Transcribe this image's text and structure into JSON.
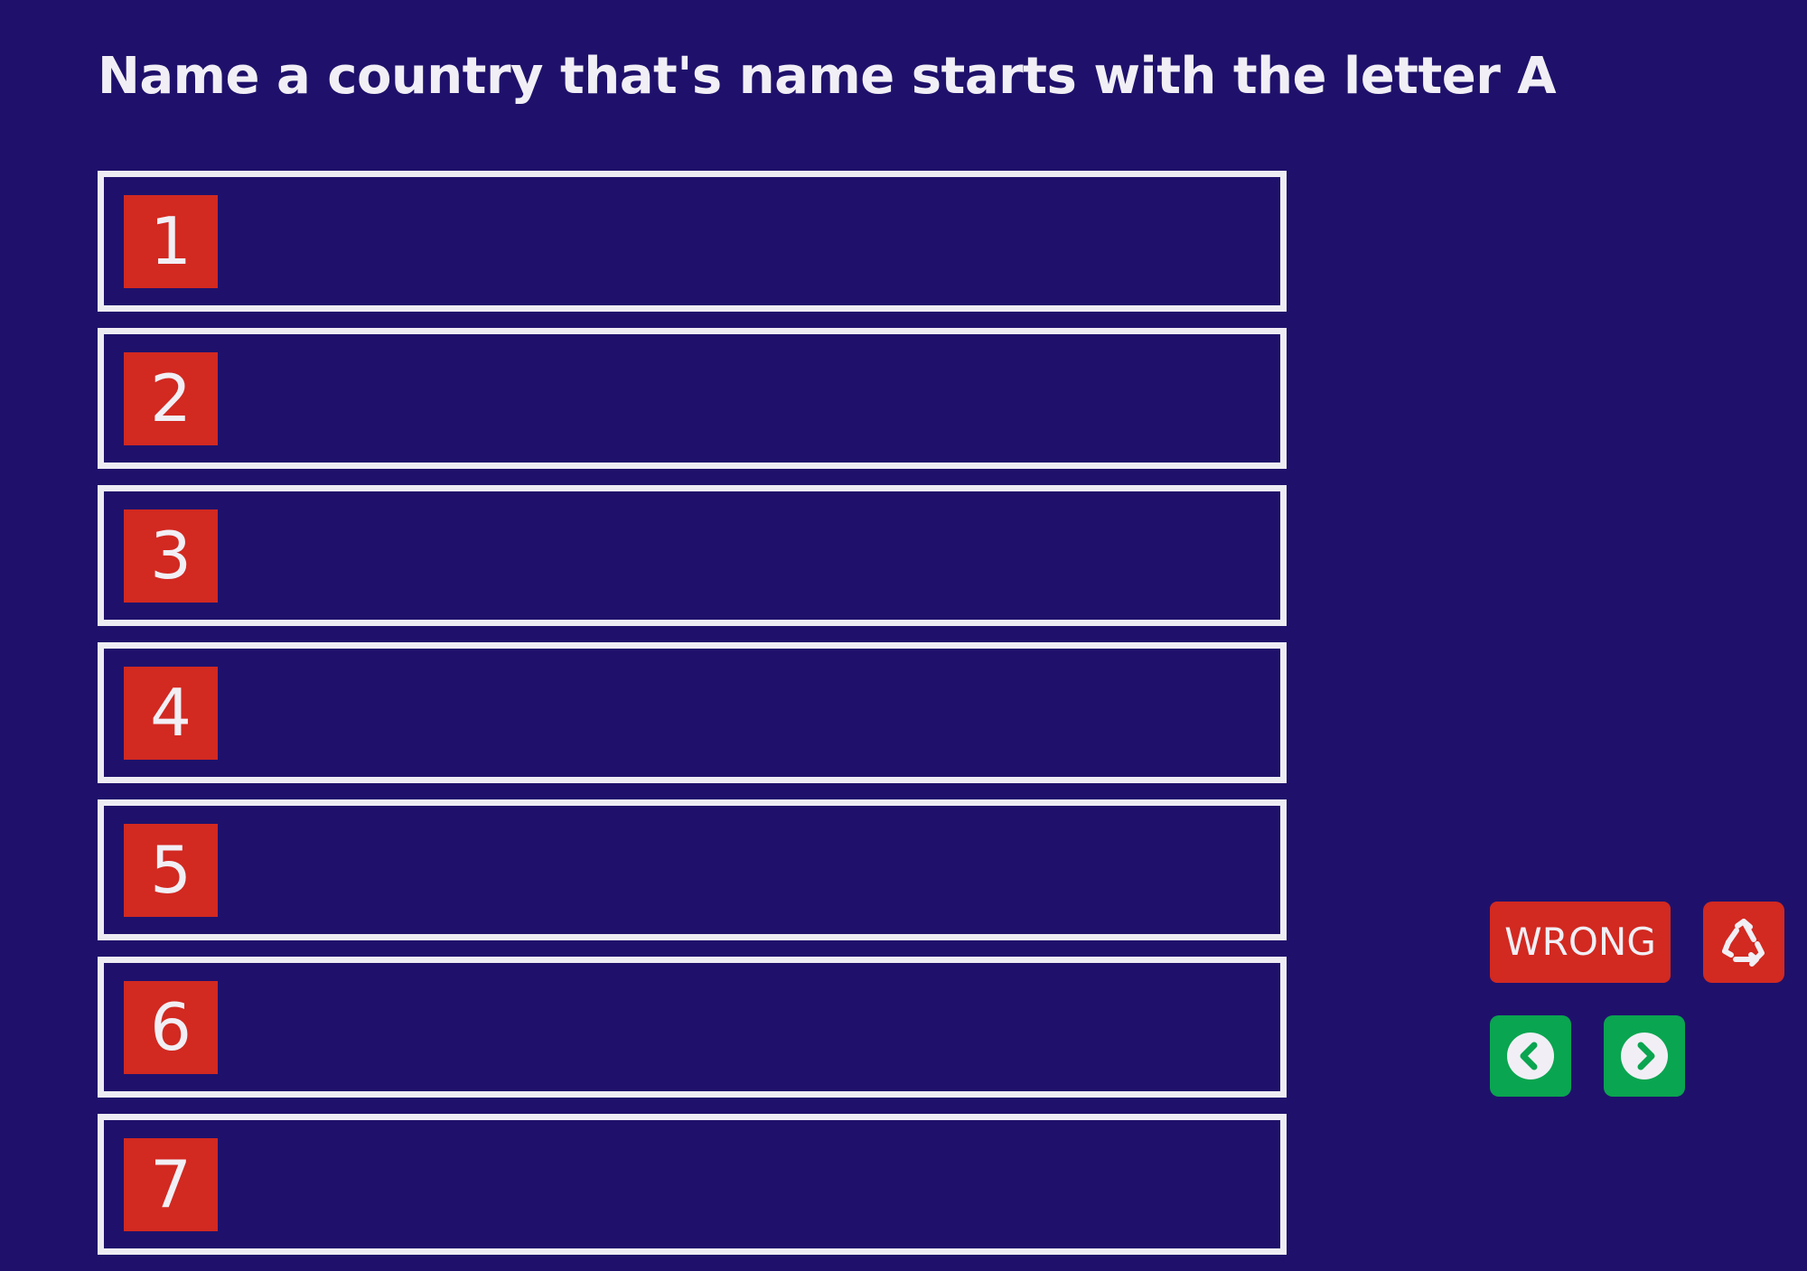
{
  "question": "Name a country that's name starts with the letter A",
  "answers": [
    {
      "rank": "1",
      "text": ""
    },
    {
      "rank": "2",
      "text": ""
    },
    {
      "rank": "3",
      "text": ""
    },
    {
      "rank": "4",
      "text": ""
    },
    {
      "rank": "5",
      "text": ""
    },
    {
      "rank": "6",
      "text": ""
    },
    {
      "rank": "7",
      "text": ""
    }
  ],
  "controls": {
    "wrong_label": "WRONG",
    "reset_icon": "recycle-icon",
    "prev_icon": "chevron-left-circle-icon",
    "next_icon": "chevron-right-circle-icon"
  },
  "colors": {
    "background": "#1f116b",
    "rank_badge": "#d22921",
    "wrong_button": "#d22921",
    "nav_button": "#0aa550",
    "text": "#f1eff5"
  }
}
